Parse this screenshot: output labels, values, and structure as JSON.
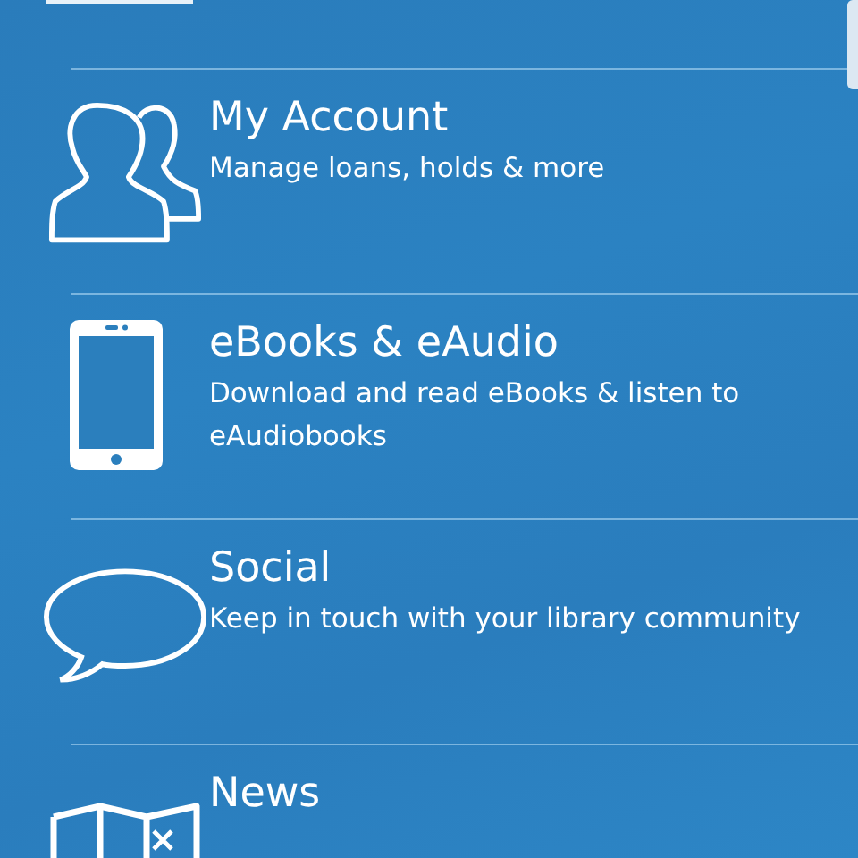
{
  "menu": [
    {
      "kind": "people",
      "title": "My Account",
      "subtitle": "Manage loans, holds & more"
    },
    {
      "kind": "phone",
      "title": "eBooks & eAudio",
      "subtitle": "Download and read eBooks & listen to eAudiobooks"
    },
    {
      "kind": "speech",
      "title": "Social",
      "subtitle": "Keep in touch with your library community"
    },
    {
      "kind": "map",
      "title": "News"
    }
  ]
}
